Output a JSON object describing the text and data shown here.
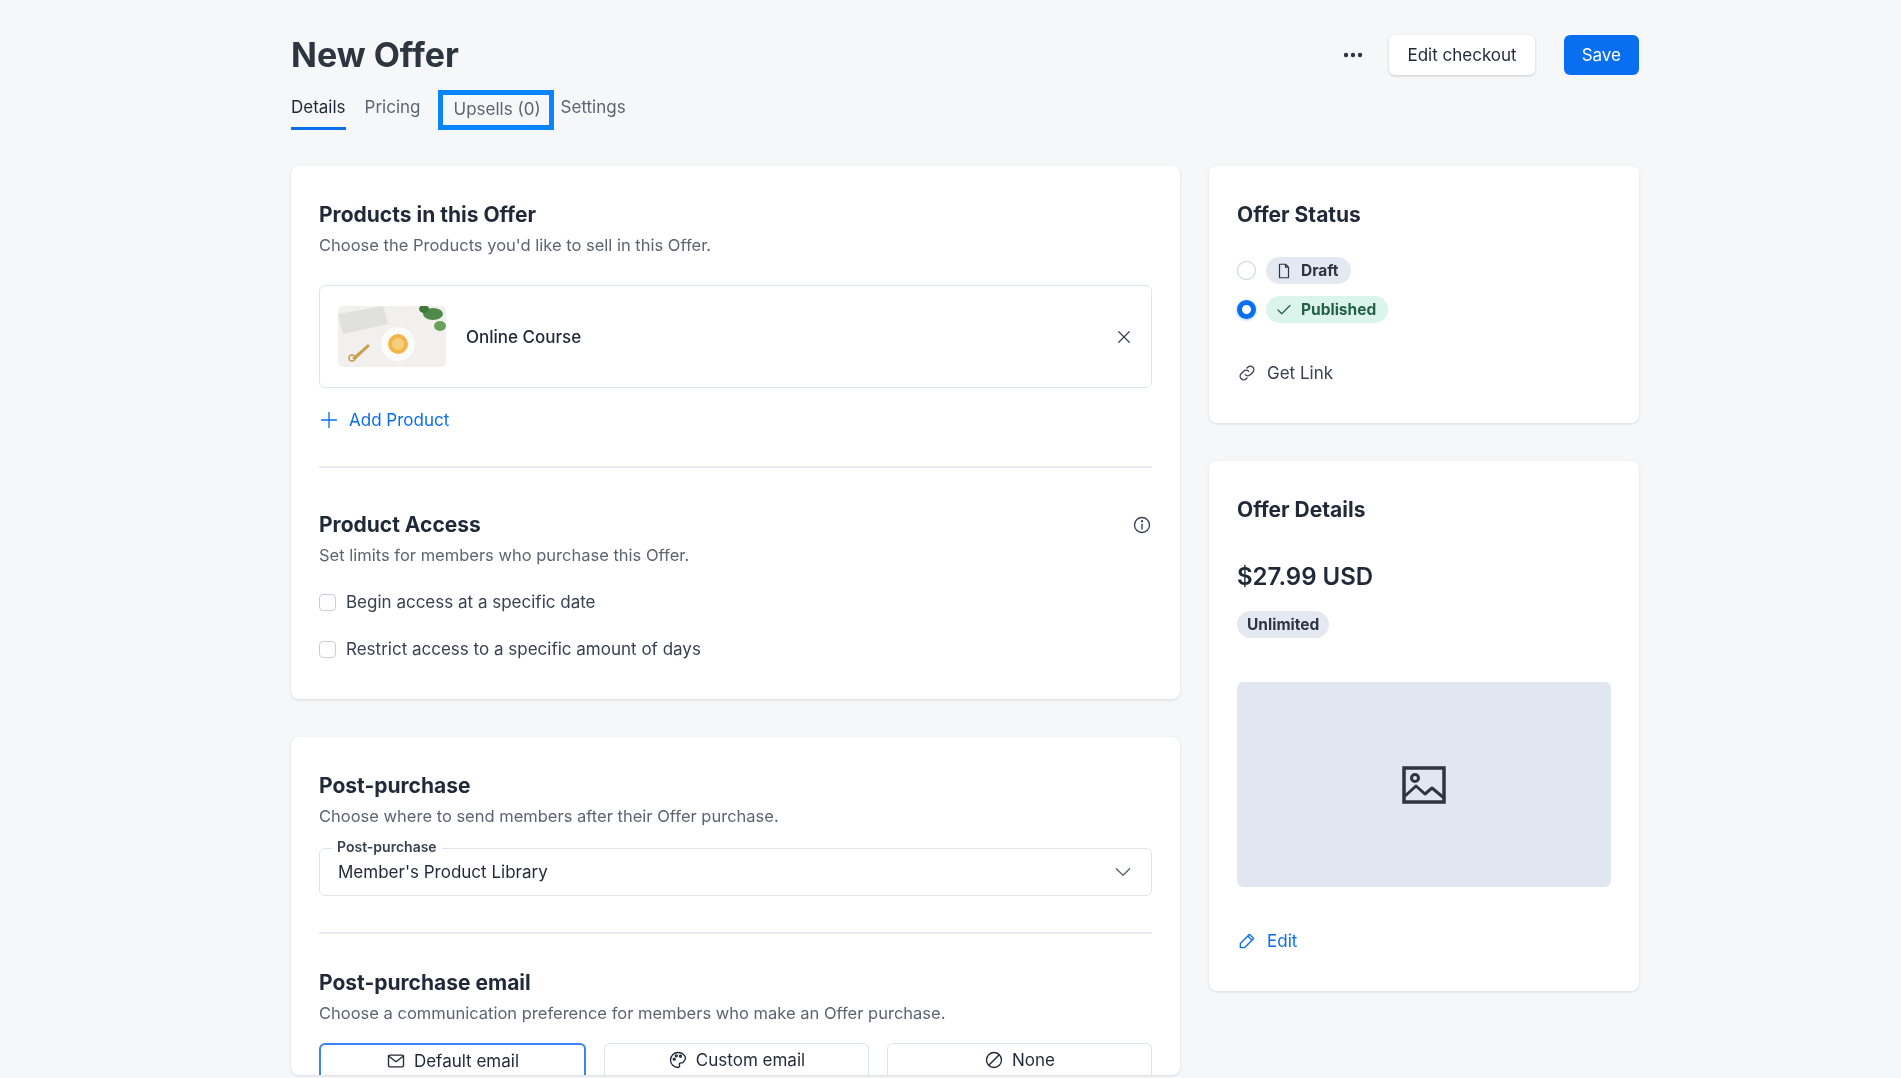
{
  "page": {
    "title": "New Offer"
  },
  "actions": [
    {
      "label": "Edit checkout",
      "kind": "secondary"
    },
    {
      "label": "Save",
      "kind": "primary"
    }
  ],
  "tabs": [
    {
      "label": "Details",
      "selected": true,
      "highlighted": false
    },
    {
      "label": "Pricing",
      "selected": false,
      "highlighted": false
    },
    {
      "label": "Upsells (0)",
      "selected": false,
      "highlighted": true
    },
    {
      "label": "Settings",
      "selected": false,
      "highlighted": false
    }
  ],
  "products_section": {
    "title": "Products in this Offer",
    "description": "Choose the Products you'd like to sell in this Offer.",
    "products": [
      {
        "name": "Online Course"
      }
    ],
    "add_label": "Add Product"
  },
  "access_section": {
    "title": "Product Access",
    "description": "Set limits for members who purchase this Offer.",
    "options": [
      {
        "label": "Begin access at a specific date",
        "checked": false
      },
      {
        "label": "Restrict access to a specific amount of days",
        "checked": false
      }
    ]
  },
  "post_purchase": {
    "title": "Post-purchase",
    "description": "Choose where to send members after their Offer purchase.",
    "select": {
      "label": "Post-purchase",
      "value": "Member's Product Library"
    }
  },
  "email_section": {
    "title": "Post-purchase email",
    "description": "Choose a communication preference for members who make an Offer purchase.",
    "options": [
      {
        "label": "Default email",
        "kind": "default",
        "selected": true
      },
      {
        "label": "Custom email",
        "kind": "custom",
        "selected": false
      },
      {
        "label": "None",
        "kind": "none",
        "selected": false
      }
    ]
  },
  "offer_status": {
    "title": "Offer Status",
    "statuses": [
      {
        "label": "Draft",
        "kind": "draft",
        "selected": false
      },
      {
        "label": "Published",
        "kind": "published",
        "selected": true
      }
    ],
    "link_label": "Get Link"
  },
  "offer_details": {
    "title": "Offer Details",
    "price": "$27.99 USD",
    "badge": "Unlimited",
    "edit_label": "Edit"
  }
}
